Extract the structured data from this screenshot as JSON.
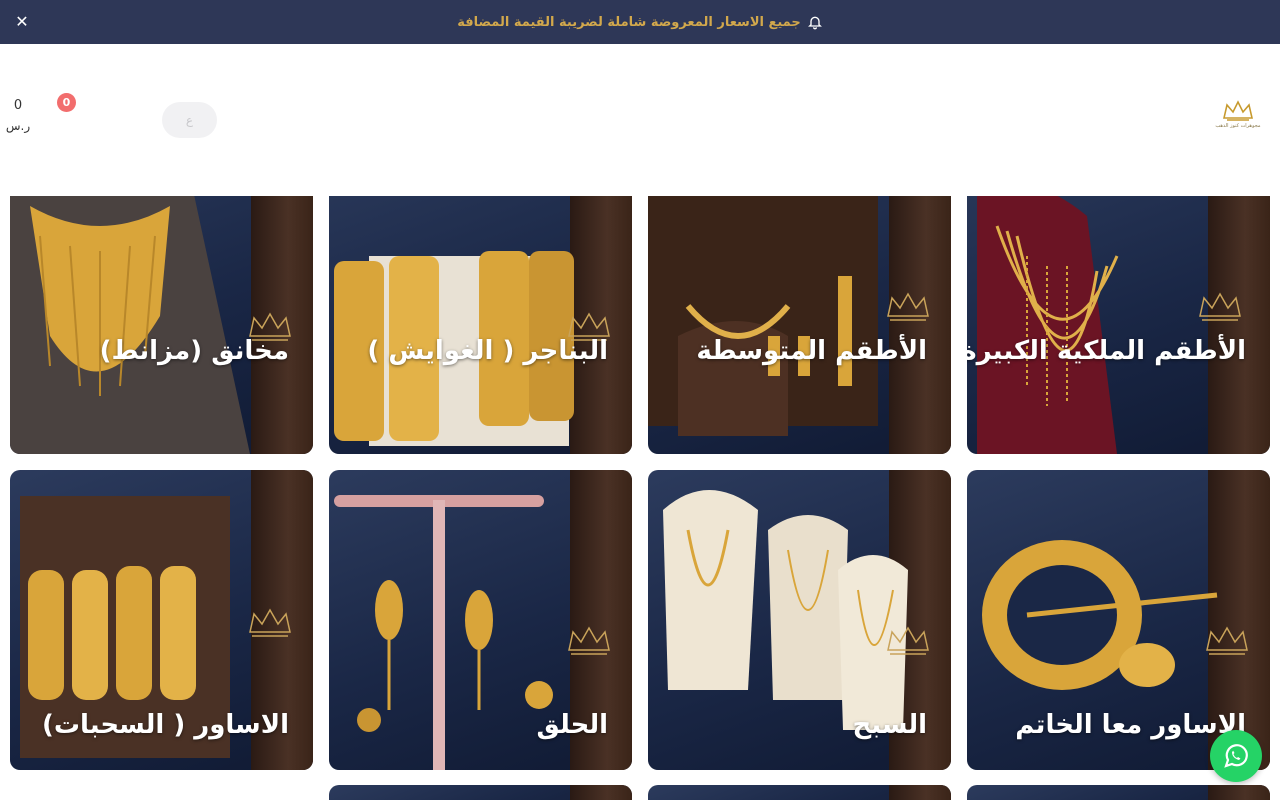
{
  "announcement": {
    "text": "جميع الاسعار المعروضة شاملة لضريبة القيمة المضافة",
    "icon": "bell-icon",
    "close_icon": "close-icon"
  },
  "header": {
    "logo_caption": "مجوهرات كنوز الذهب",
    "cart_total": "0",
    "currency_symbol": "ر.س",
    "cart_count": "0",
    "language_label": "ع"
  },
  "categories": [
    {
      "title": "الأطقم الملكية الكبيرة"
    },
    {
      "title": "الأطقم المتوسطة"
    },
    {
      "title": "البناجر ( الغوايش )"
    },
    {
      "title": "مخانق (مزانط)"
    },
    {
      "title": "الاساور معا الخاتم"
    },
    {
      "title": "السبح"
    },
    {
      "title": "الحلق"
    },
    {
      "title": "الاساور ( السحبات)"
    }
  ],
  "colors": {
    "announcement_bg": "#2e3757",
    "announcement_text": "#d2a84c",
    "card_bg": "#1a2746",
    "gold": "#d4a62a",
    "badge": "#f26d6d",
    "whatsapp": "#25d366"
  },
  "floating": {
    "whatsapp_icon": "whatsapp-icon"
  }
}
